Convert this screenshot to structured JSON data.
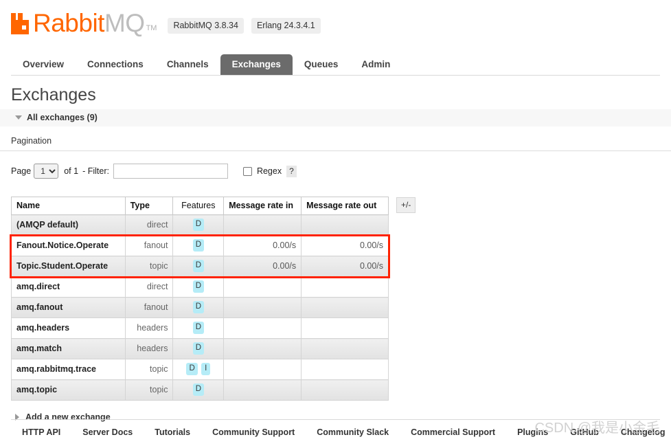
{
  "header": {
    "brand_rabbit": "Rabbit",
    "brand_mq": "MQ",
    "trademark": "TM",
    "badges": [
      {
        "label": "RabbitMQ 3.8.34"
      },
      {
        "label": "Erlang 24.3.4.1"
      }
    ],
    "logo_color": "#ff6600"
  },
  "nav": {
    "tabs": [
      {
        "label": "Overview",
        "active": false
      },
      {
        "label": "Connections",
        "active": false
      },
      {
        "label": "Channels",
        "active": false
      },
      {
        "label": "Exchanges",
        "active": true
      },
      {
        "label": "Queues",
        "active": false
      },
      {
        "label": "Admin",
        "active": false
      }
    ],
    "active_bg": "#6b6b6b"
  },
  "page": {
    "title": "Exchanges",
    "section_header": "All exchanges (9)",
    "pagination_label": "Pagination"
  },
  "pagination": {
    "page_label": "Page",
    "page_value": "1",
    "page_options": [
      "1"
    ],
    "of_text": "of 1",
    "filter_label": "- Filter:",
    "filter_value": "",
    "filter_placeholder": "",
    "regex_label": "Regex",
    "regex_checked": false,
    "help_label": "?"
  },
  "table": {
    "columns": [
      {
        "label": "Name",
        "align": "left",
        "bold": true
      },
      {
        "label": "Type",
        "align": "left",
        "bold": true
      },
      {
        "label": "Features",
        "align": "center",
        "bold": false
      },
      {
        "label": "Message rate in",
        "align": "left",
        "bold": true
      },
      {
        "label": "Message rate out",
        "align": "left",
        "bold": true
      }
    ],
    "toggle_columns_label": "+/-",
    "rows": [
      {
        "name": "(AMQP default)",
        "type": "direct",
        "features": [
          "D"
        ],
        "rate_in": "",
        "rate_out": "",
        "highlighted": false
      },
      {
        "name": "Fanout.Notice.Operate",
        "type": "fanout",
        "features": [
          "D"
        ],
        "rate_in": "0.00/s",
        "rate_out": "0.00/s",
        "highlighted": true
      },
      {
        "name": "Topic.Student.Operate",
        "type": "topic",
        "features": [
          "D"
        ],
        "rate_in": "0.00/s",
        "rate_out": "0.00/s",
        "highlighted": true
      },
      {
        "name": "amq.direct",
        "type": "direct",
        "features": [
          "D"
        ],
        "rate_in": "",
        "rate_out": "",
        "highlighted": false
      },
      {
        "name": "amq.fanout",
        "type": "fanout",
        "features": [
          "D"
        ],
        "rate_in": "",
        "rate_out": "",
        "highlighted": false
      },
      {
        "name": "amq.headers",
        "type": "headers",
        "features": [
          "D"
        ],
        "rate_in": "",
        "rate_out": "",
        "highlighted": false
      },
      {
        "name": "amq.match",
        "type": "headers",
        "features": [
          "D"
        ],
        "rate_in": "",
        "rate_out": "",
        "highlighted": false
      },
      {
        "name": "amq.rabbitmq.trace",
        "type": "topic",
        "features": [
          "D",
          "I"
        ],
        "rate_in": "",
        "rate_out": "",
        "highlighted": false
      },
      {
        "name": "amq.topic",
        "type": "topic",
        "features": [
          "D"
        ],
        "rate_in": "",
        "rate_out": "",
        "highlighted": false
      }
    ],
    "badge_color": "#b5ecf7",
    "annotation_color": "#ff2200"
  },
  "add_exchange": {
    "label": "Add a new exchange"
  },
  "footer": {
    "links": [
      {
        "label": "HTTP API"
      },
      {
        "label": "Server Docs"
      },
      {
        "label": "Tutorials"
      },
      {
        "label": "Community Support"
      },
      {
        "label": "Community Slack"
      },
      {
        "label": "Commercial Support"
      },
      {
        "label": "Plugins"
      },
      {
        "label": "GitHub"
      },
      {
        "label": "Changelog"
      }
    ],
    "watermark": "CSDN @我是小金毛"
  }
}
